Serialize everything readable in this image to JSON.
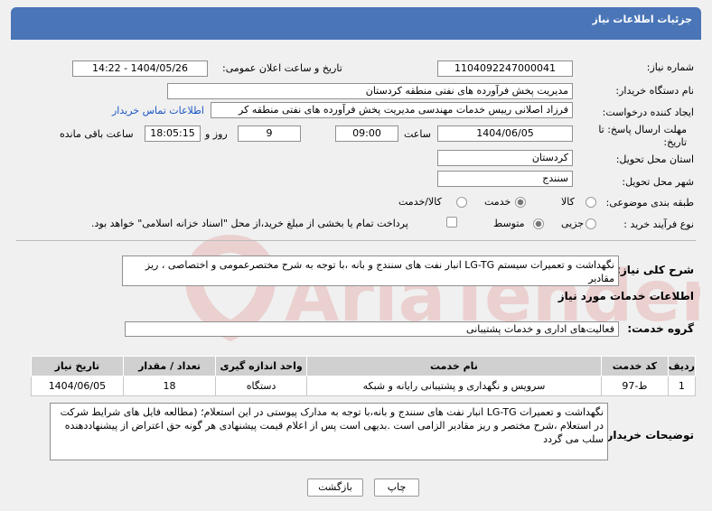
{
  "header": {
    "title": "جزئیات اطلاعات نیاز"
  },
  "form": {
    "need_number_label": "شماره نیاز:",
    "need_number": "1104092247000041",
    "announce_label": "تاریخ و ساعت اعلان عمومی:",
    "announce_value": "1404/05/26 - 14:22",
    "buyer_label": "نام دستگاه خریدار:",
    "buyer_value": "مدیریت پخش فرآورده های نفتی منطقه کردستان",
    "creator_label": "ایجاد کننده درخواست:",
    "creator_value": "فرزاد اصلانی رییس خدمات مهندسی مدیریت پخش فرآورده های نفتی منطقه کر",
    "contact_link": "اطلاعات تماس خریدار",
    "deadline_label": "مهلت ارسال پاسخ: تا تاریخ:",
    "deadline_date": "1404/06/05",
    "time_label": "ساعت",
    "deadline_time": "09:00",
    "days_value": "9",
    "days_label": "روز و",
    "remaining_time": "18:05:15",
    "remaining_label": "ساعت باقی مانده",
    "province_label": "استان محل تحویل:",
    "province_value": "کردستان",
    "city_label": "شهر محل تحویل:",
    "city_value": "سنندج",
    "category_label": "طبقه بندی موضوعی:",
    "category_options": [
      "کالا",
      "خدمت",
      "کالا/خدمت"
    ],
    "process_label": "نوع فرآیند خرید :",
    "process_options": [
      "جزیی",
      "متوسط"
    ],
    "payment_note": "پرداخت تمام یا بخشی از مبلغ خرید،از محل \"اسناد خزانه اسلامی\" خواهد بود."
  },
  "summary": {
    "label": "شرح کلی نیاز:",
    "text": "نگهداشت و تعمیرات سیستم LG-TG  انبار نفت های سنندج و بانه ،با توجه به شرح مختصرعمومی و اختصاصی ، ریز مقادیر"
  },
  "services": {
    "section_title": "اطلاعات خدمات مورد نیاز",
    "group_label": "گروه خدمت:",
    "group_value": "فعالیت‌های اداری و خدمات پشتیبانی",
    "columns": [
      "ردیف",
      "کد خدمت",
      "نام خدمت",
      "واحد اندازه گیری",
      "تعداد / مقدار",
      "تاریخ نیاز"
    ],
    "rows": [
      [
        "1",
        "ط-97",
        "سرویس و نگهداری و پشتیبانی رایانه و شبکه",
        "دستگاه",
        "18",
        "1404/06/05"
      ]
    ]
  },
  "buyer_notes": {
    "label": "توضیحات خریدار:",
    "text": "نگهداشت و تعمیرات LG-TG انبار نفت های سنندج و بانه،با توجه به مدارک پیوستی در این استعلام؛ (مطالعه فایل های شرایط شرکت در استعلام ،شرح مختصر و ریز مقادیر  الزامی است .بدیهی است پس از اعلام قیمت پیشنهادی هر گونه حق اعتراض از پیشنهاددهنده سلب می گردد"
  },
  "buttons": {
    "print": "چاپ",
    "back": "بازگشت"
  },
  "watermark": "AriaTender.net"
}
